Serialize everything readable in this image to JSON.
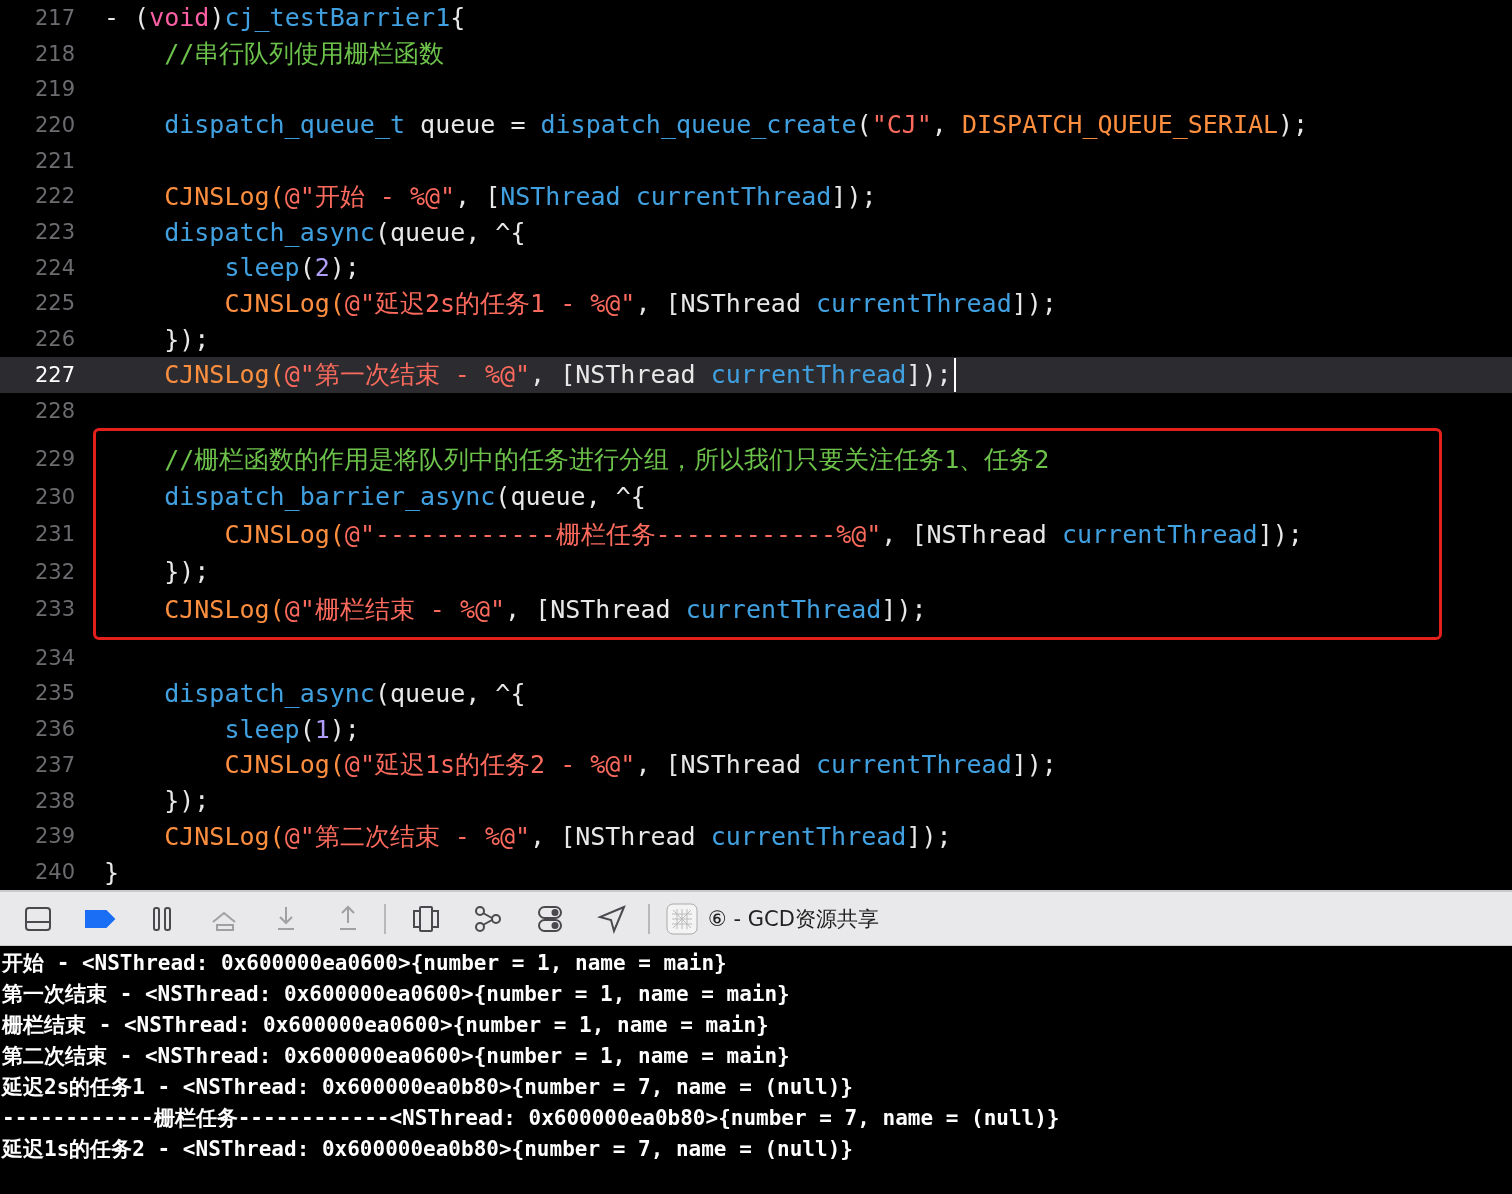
{
  "editor": {
    "sections": [
      {
        "kind": "plain",
        "lines": [
          {
            "number": "217",
            "current": false,
            "tokens": [
              {
                "kind": "p",
                "text": "- ("
              },
              {
                "kind": "kw",
                "text": "void"
              },
              {
                "kind": "p",
                "text": ")"
              },
              {
                "kind": "fn",
                "text": "cj_testBarrier1"
              },
              {
                "kind": "p",
                "text": "{"
              }
            ]
          },
          {
            "number": "218",
            "current": false,
            "tokens": [
              {
                "kind": "cm",
                "text": "    //串行队列使用栅栏函数"
              }
            ]
          },
          {
            "number": "219",
            "current": false
          },
          {
            "number": "220",
            "current": false,
            "tokens": [
              {
                "kind": "fn",
                "text": "    dispatch_queue_t"
              },
              {
                "kind": "p",
                "text": " queue = "
              },
              {
                "kind": "fn",
                "text": "dispatch_queue_create"
              },
              {
                "kind": "p",
                "text": "("
              },
              {
                "kind": "str",
                "text": "\"CJ\""
              },
              {
                "kind": "p",
                "text": ", "
              },
              {
                "kind": "mac",
                "text": "DISPATCH_QUEUE_SERIAL"
              },
              {
                "kind": "p",
                "text": ");"
              }
            ]
          },
          {
            "number": "221",
            "current": false
          },
          {
            "number": "222",
            "current": false,
            "tokens": [
              {
                "kind": "mac",
                "text": "    CJNSLog("
              },
              {
                "kind": "str",
                "text": "@\"开始 - %@\""
              },
              {
                "kind": "p",
                "text": ", ["
              },
              {
                "kind": "fn",
                "text": "NSThread currentThread"
              },
              {
                "kind": "p",
                "text": "]);"
              }
            ]
          },
          {
            "number": "223",
            "current": false,
            "tokens": [
              {
                "kind": "fn",
                "text": "    dispatch_async"
              },
              {
                "kind": "p",
                "text": "(queue, ^{"
              }
            ]
          },
          {
            "number": "224",
            "current": false,
            "tokens": [
              {
                "kind": "fn",
                "text": "        sleep"
              },
              {
                "kind": "p",
                "text": "("
              },
              {
                "kind": "num",
                "text": "2"
              },
              {
                "kind": "p",
                "text": ");"
              }
            ]
          },
          {
            "number": "225",
            "current": false,
            "tokens": [
              {
                "kind": "mac",
                "text": "        CJNSLog("
              },
              {
                "kind": "str",
                "text": "@\"延迟2s的任务1 - %@\""
              },
              {
                "kind": "p",
                "text": ", [NSThread "
              },
              {
                "kind": "fn",
                "text": "currentThread"
              },
              {
                "kind": "p",
                "text": "]);"
              }
            ]
          },
          {
            "number": "226",
            "current": false,
            "tokens": [
              {
                "kind": "p",
                "text": "    });"
              }
            ]
          },
          {
            "number": "227",
            "current": true,
            "tokens": [
              {
                "kind": "mac",
                "text": "    CJNSLog("
              },
              {
                "kind": "str",
                "text": "@\"第一次结束 - %@\""
              },
              {
                "kind": "p",
                "text": ", [NSThread "
              },
              {
                "kind": "fn",
                "text": "currentThread"
              },
              {
                "kind": "p",
                "text": "]);"
              }
            ]
          },
          {
            "number": "228",
            "current": false
          }
        ]
      },
      {
        "kind": "marked",
        "lines": [
          {
            "number": "229",
            "current": false,
            "tokens": [
              {
                "kind": "cm",
                "text": "    //栅栏函数的作用是将队列中的任务进行分组，所以我们只要关注任务1、任务2"
              }
            ]
          },
          {
            "number": "230",
            "current": false,
            "tokens": [
              {
                "kind": "fn",
                "text": "    dispatch_barrier_async"
              },
              {
                "kind": "p",
                "text": "(queue, ^{"
              }
            ]
          },
          {
            "number": "231",
            "current": false,
            "tokens": [
              {
                "kind": "mac",
                "text": "        CJNSLog("
              },
              {
                "kind": "str",
                "text": "@\"------------栅栏任务------------%@\""
              },
              {
                "kind": "p",
                "text": ", [NSThread "
              },
              {
                "kind": "fn",
                "text": "currentThread"
              },
              {
                "kind": "p",
                "text": "]);"
              }
            ]
          },
          {
            "number": "232",
            "current": false,
            "tokens": [
              {
                "kind": "p",
                "text": "    });"
              }
            ]
          },
          {
            "number": "233",
            "current": false,
            "tokens": [
              {
                "kind": "mac",
                "text": "    CJNSLog("
              },
              {
                "kind": "str",
                "text": "@\"栅栏结束 - %@\""
              },
              {
                "kind": "p",
                "text": ", [NSThread "
              },
              {
                "kind": "fn",
                "text": "currentThread"
              },
              {
                "kind": "p",
                "text": "]);"
              }
            ]
          }
        ]
      },
      {
        "kind": "plain",
        "lines": [
          {
            "number": "234",
            "current": false
          },
          {
            "number": "235",
            "current": false,
            "tokens": [
              {
                "kind": "fn",
                "text": "    dispatch_async"
              },
              {
                "kind": "p",
                "text": "(queue, ^{"
              }
            ]
          },
          {
            "number": "236",
            "current": false,
            "tokens": [
              {
                "kind": "fn",
                "text": "        sleep"
              },
              {
                "kind": "p",
                "text": "("
              },
              {
                "kind": "num",
                "text": "1"
              },
              {
                "kind": "p",
                "text": ");"
              }
            ]
          },
          {
            "number": "237",
            "current": false,
            "tokens": [
              {
                "kind": "mac",
                "text": "        CJNSLog("
              },
              {
                "kind": "str",
                "text": "@\"延迟1s的任务2 - %@\""
              },
              {
                "kind": "p",
                "text": ", [NSThread "
              },
              {
                "kind": "fn",
                "text": "currentThread"
              },
              {
                "kind": "p",
                "text": "]);"
              }
            ]
          },
          {
            "number": "238",
            "current": false,
            "tokens": [
              {
                "kind": "p",
                "text": "    });"
              }
            ]
          },
          {
            "number": "239",
            "current": false,
            "tokens": [
              {
                "kind": "mac",
                "text": "    CJNSLog("
              },
              {
                "kind": "str",
                "text": "@\"第二次结束 - %@\""
              },
              {
                "kind": "p",
                "text": ", [NSThread "
              },
              {
                "kind": "fn",
                "text": "currentThread"
              },
              {
                "kind": "p",
                "text": "]);"
              }
            ]
          },
          {
            "number": "240",
            "current": false,
            "tokens": [
              {
                "kind": "p",
                "text": "}"
              }
            ]
          }
        ]
      }
    ]
  },
  "debug_bar": {
    "groups": [
      {
        "buttons": [
          {
            "kind": "panel",
            "disabled": false
          },
          {
            "kind": "breakpoints",
            "on": true,
            "disabled": false
          },
          {
            "kind": "pause",
            "disabled": false
          },
          {
            "kind": "step-over",
            "disabled": true
          },
          {
            "kind": "step-into",
            "disabled": true
          },
          {
            "kind": "step-out",
            "disabled": true
          }
        ]
      },
      {
        "buttons": [
          {
            "kind": "view-debugger",
            "disabled": false
          },
          {
            "kind": "memory-graph",
            "disabled": false
          },
          {
            "kind": "environment",
            "disabled": false
          },
          {
            "kind": "location",
            "disabled": false
          }
        ]
      }
    ],
    "target": {
      "label": "⑥ - GCD资源共享"
    }
  },
  "console": {
    "lines": [
      "开始 - <NSThread: 0x600000ea0600>{number = 1, name = main}",
      "第一次结束 - <NSThread: 0x600000ea0600>{number = 1, name = main}",
      "栅栏结束 - <NSThread: 0x600000ea0600>{number = 1, name = main}",
      "第二次结束 - <NSThread: 0x600000ea0600>{number = 1, name = main}",
      "延迟2s的任务1 - <NSThread: 0x600000ea0b80>{number = 7, name = (null)}",
      "------------栅栏任务------------<NSThread: 0x600000ea0b80>{number = 7, name = (null)}",
      "延迟1s的任务2 - <NSThread: 0x600000ea0b80>{number = 7, name = (null)}"
    ]
  }
}
